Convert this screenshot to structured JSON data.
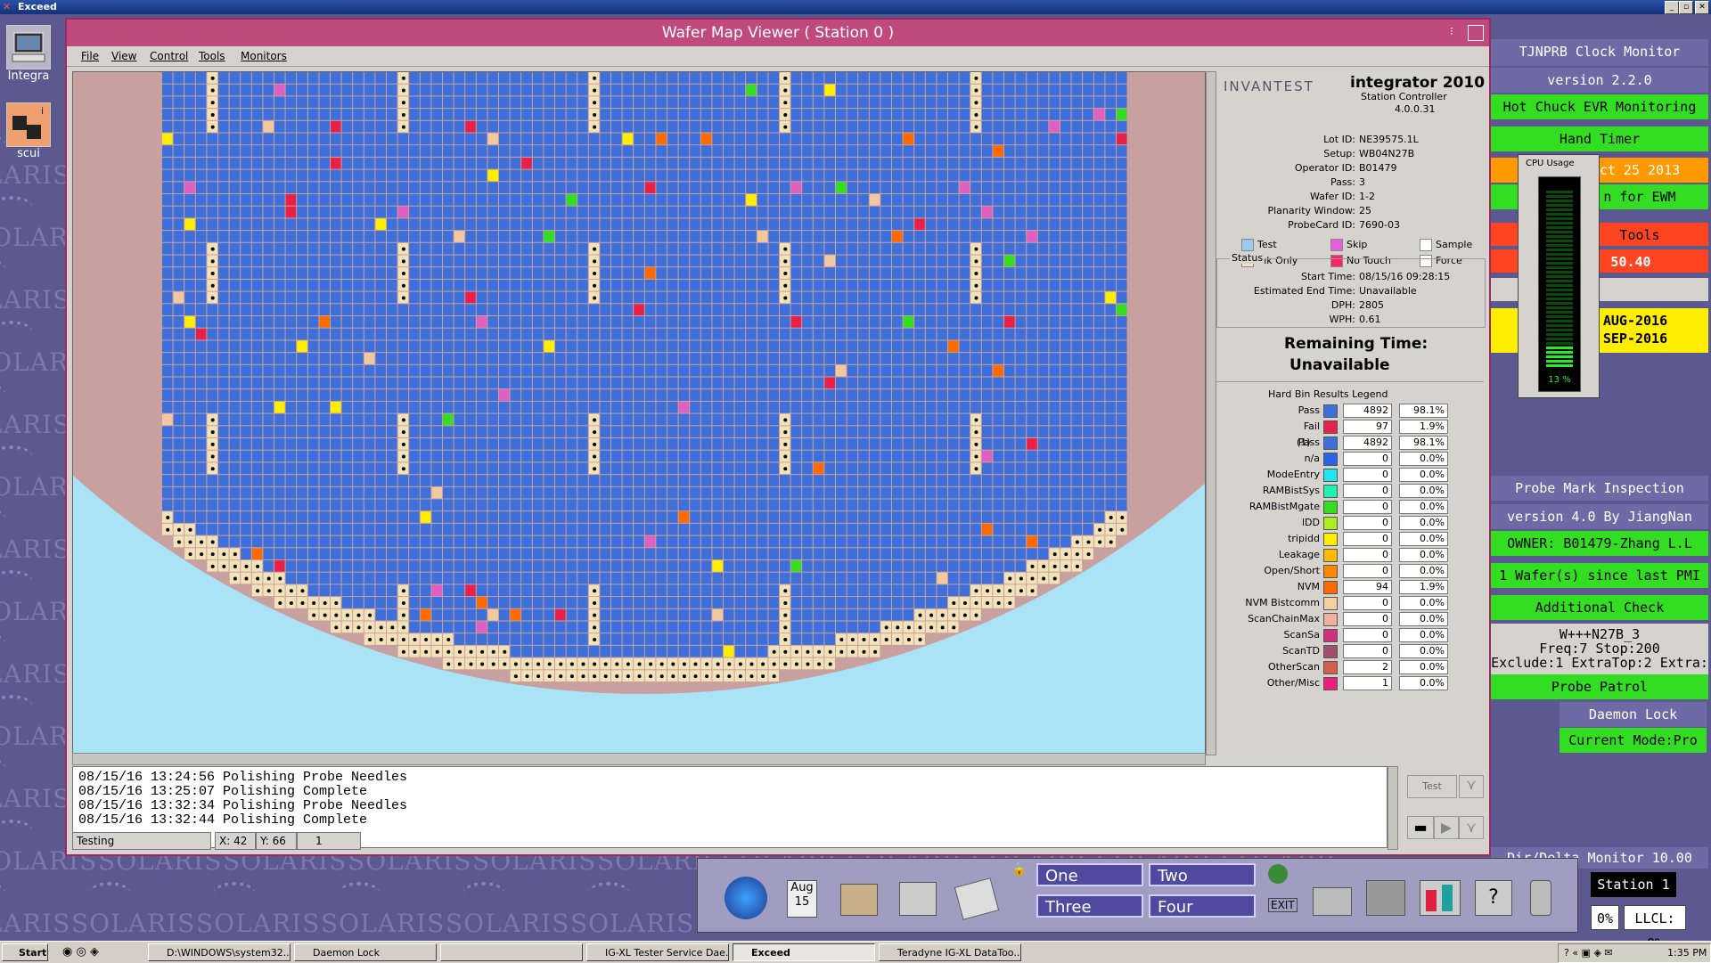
{
  "app_bar": {
    "title": "Exceed"
  },
  "desktop_icons": [
    {
      "label": "Integra"
    },
    {
      "label": "scui"
    }
  ],
  "window": {
    "title": "Wafer Map Viewer ( Station 0 )",
    "menu": [
      "File",
      "View",
      "Control",
      "Tools",
      "Monitors"
    ]
  },
  "info": {
    "brand": "INVANTEST",
    "product": "integrator 2010",
    "subtitle": "Station Controller",
    "version": "4.0.0.31",
    "fields": [
      {
        "label": "Lot ID:",
        "value": "NE39575.1L"
      },
      {
        "label": "Setup:",
        "value": "WB04N27B"
      },
      {
        "label": "Operator ID:",
        "value": "B01479"
      },
      {
        "label": "Pass:",
        "value": "3"
      },
      {
        "label": "Wafer ID:",
        "value": "1-2"
      },
      {
        "label": "Planarity Window:",
        "value": "25"
      },
      {
        "label": "ProbeCard ID:",
        "value": "7690-03"
      }
    ],
    "map_legend": [
      {
        "label": "Test",
        "color": "#9ec8ef"
      },
      {
        "label": "Skip",
        "color": "#e060e0"
      },
      {
        "label": "Sample",
        "color": "#ffffff"
      },
      {
        "label": "Ink Only",
        "color": "#f2e2b8"
      },
      {
        "label": "No Touch",
        "color": "#ff2266"
      },
      {
        "label": "Force",
        "color": "#ffffff"
      }
    ],
    "status_title": "Status",
    "status": [
      {
        "label": "Start Time:",
        "value": "08/15/16 09:28:15"
      },
      {
        "label": "Estimated End Time:",
        "value": "Unavailable"
      },
      {
        "label": "DPH:",
        "value": "2805"
      },
      {
        "label": "WPH:",
        "value": "0.61"
      }
    ],
    "remaining_label": "Remaining Time:",
    "remaining_value": "Unavailable",
    "bin_legend_title": "Hard Bin Results Legend",
    "bins": [
      {
        "name": "Pass",
        "color": "#3f6fd9",
        "count": "4892",
        "pct": "98.1%"
      },
      {
        "name": "Fail",
        "color": "#e8214a",
        "count": "97",
        "pct": "1.9%"
      },
      {
        "name": "Pass",
        "suffix": "(1)",
        "color": "#3f6fd9",
        "count": "4892",
        "pct": "98.1%"
      },
      {
        "name": "n/a",
        "color": "#2b63e8",
        "count": "0",
        "pct": "0.0%"
      },
      {
        "name": "ModeEntry",
        "color": "#22e5f0",
        "count": "0",
        "pct": "0.0%"
      },
      {
        "name": "RAMBistSys",
        "color": "#22f0b0",
        "count": "0",
        "pct": "0.0%"
      },
      {
        "name": "RAMBistMgate",
        "color": "#33dd22",
        "count": "0",
        "pct": "0.0%"
      },
      {
        "name": "IDD",
        "color": "#aaee22",
        "count": "0",
        "pct": "0.0%"
      },
      {
        "name": "tripidd",
        "color": "#ffee00",
        "count": "0",
        "pct": "0.0%"
      },
      {
        "name": "Leakage",
        "color": "#ffbb00",
        "count": "0",
        "pct": "0.0%"
      },
      {
        "name": "Open/Short",
        "color": "#ff8800",
        "count": "0",
        "pct": "0.0%"
      },
      {
        "name": "NVM",
        "color": "#ff6a00",
        "count": "94",
        "pct": "1.9%"
      },
      {
        "name": "NVM Bistcomm",
        "color": "#f5d0a0",
        "count": "0",
        "pct": "0.0%"
      },
      {
        "name": "ScanChainMax",
        "color": "#f0b0a0",
        "count": "0",
        "pct": "0.0%"
      },
      {
        "name": "ScanSa",
        "color": "#d03080",
        "count": "0",
        "pct": "0.0%"
      },
      {
        "name": "ScanTD",
        "color": "#a0506a",
        "count": "0",
        "pct": "0.0%"
      },
      {
        "name": "OtherScan",
        "color": "#d06050",
        "count": "2",
        "pct": "0.0%"
      },
      {
        "name": "Other/Misc",
        "color": "#e8207a",
        "count": "1",
        "pct": "0.0%"
      }
    ]
  },
  "log": [
    "08/15/16 13:24:56 Polishing Probe Needles",
    "08/15/16 13:25:07 Polishing Complete",
    "08/15/16 13:32:34 Polishing Probe Needles",
    "08/15/16 13:32:44 Polishing Complete"
  ],
  "statusbar": {
    "state": "Testing",
    "x": "X: 42",
    "y": "Y: 66",
    "count": "1"
  },
  "controls": {
    "test_label": "Test"
  },
  "right_panel": {
    "clock_title": "TJNPRB Clock Monitor",
    "clock_version": "version 2.2.0",
    "hot_chuck": "Hot Chuck EVR Monitoring",
    "hand_timer": "Hand Timer",
    "orange_date": "ct 25 2013",
    "ewm": "n for EWM",
    "tools": "Tools",
    "value": "50.40",
    "aug": "AUG-2016",
    "sep": "SEP-2016",
    "pmi_title": "Probe Mark Inspection",
    "pmi_version": "version 4.0 By JiangNan",
    "owner": "OWNER: B01479-Zhang L.L",
    "wafers_since": "1 Wafer(s) since last PMI",
    "additional": "Additional Check",
    "setup_line": "W+++N27B_3",
    "freq_line": "Freq:7 Stop:200",
    "exclude_line": "Exclude:1 ExtraTop:2 Extra:",
    "probe_patrol": "Probe Patrol",
    "daemon_lock": "Daemon Lock",
    "current_mode": "Current Mode:Pro",
    "dir_monitor": "Dir/Delta Monitor 10.00",
    "station": "Station 1",
    "pct": "0%",
    "llcl": "LLCL: 0%"
  },
  "cpu": {
    "title": "CPU Usage",
    "value": "13 %",
    "level": 0.13
  },
  "cde": {
    "workspaces": [
      "One",
      "Two",
      "Three",
      "Four"
    ],
    "date_month": "Aug",
    "date_day": "15",
    "exit": "EXIT"
  },
  "taskbar": {
    "start": "Start",
    "items": [
      "D:\\WINDOWS\\system32...",
      "Daemon Lock",
      "",
      "IG-XL Tester Service Dae...",
      "Exceed",
      "Teradyne IG-XL DataToo..."
    ],
    "clock": "1:35 PM"
  }
}
